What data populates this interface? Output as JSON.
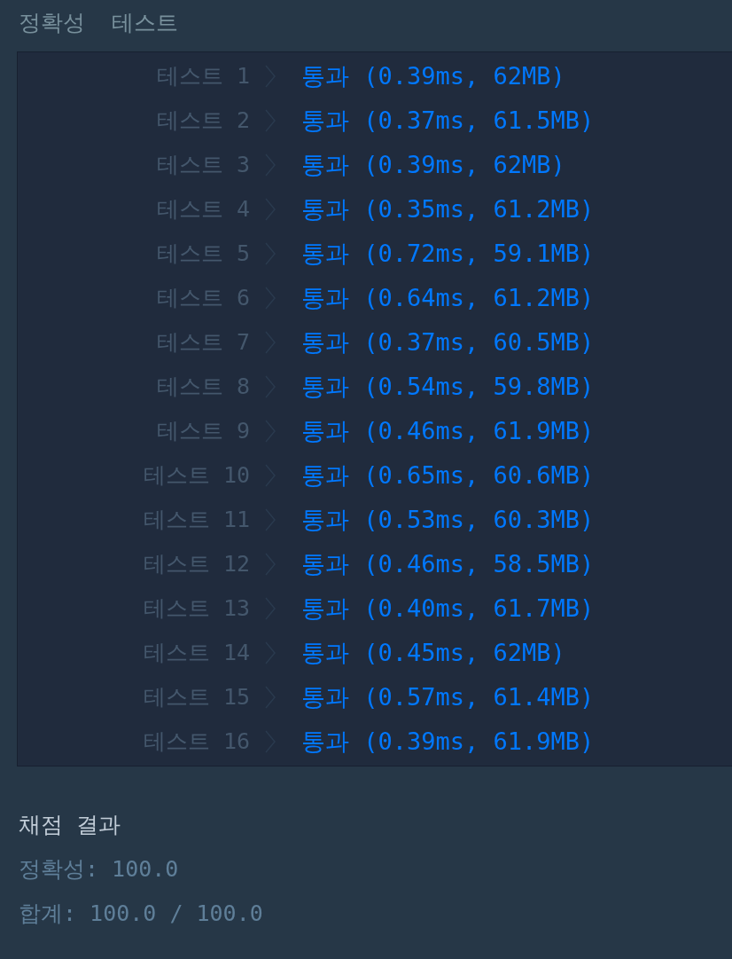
{
  "section_title": "정확성  테스트",
  "tests": [
    {
      "label": "테스트 1",
      "result": "통과 (0.39ms, 62MB)"
    },
    {
      "label": "테스트 2",
      "result": "통과 (0.37ms, 61.5MB)"
    },
    {
      "label": "테스트 3",
      "result": "통과 (0.39ms, 62MB)"
    },
    {
      "label": "테스트 4",
      "result": "통과 (0.35ms, 61.2MB)"
    },
    {
      "label": "테스트 5",
      "result": "통과 (0.72ms, 59.1MB)"
    },
    {
      "label": "테스트 6",
      "result": "통과 (0.64ms, 61.2MB)"
    },
    {
      "label": "테스트 7",
      "result": "통과 (0.37ms, 60.5MB)"
    },
    {
      "label": "테스트 8",
      "result": "통과 (0.54ms, 59.8MB)"
    },
    {
      "label": "테스트 9",
      "result": "통과 (0.46ms, 61.9MB)"
    },
    {
      "label": "테스트 10",
      "result": "통과 (0.65ms, 60.6MB)"
    },
    {
      "label": "테스트 11",
      "result": "통과 (0.53ms, 60.3MB)"
    },
    {
      "label": "테스트 12",
      "result": "통과 (0.46ms, 58.5MB)"
    },
    {
      "label": "테스트 13",
      "result": "통과 (0.40ms, 61.7MB)"
    },
    {
      "label": "테스트 14",
      "result": "통과 (0.45ms, 62MB)"
    },
    {
      "label": "테스트 15",
      "result": "통과 (0.57ms, 61.4MB)"
    },
    {
      "label": "테스트 16",
      "result": "통과 (0.39ms, 61.9MB)"
    }
  ],
  "grading": {
    "title": "채점 결과",
    "lines": [
      "정확성: 100.0",
      "합계: 100.0 / 100.0"
    ]
  }
}
